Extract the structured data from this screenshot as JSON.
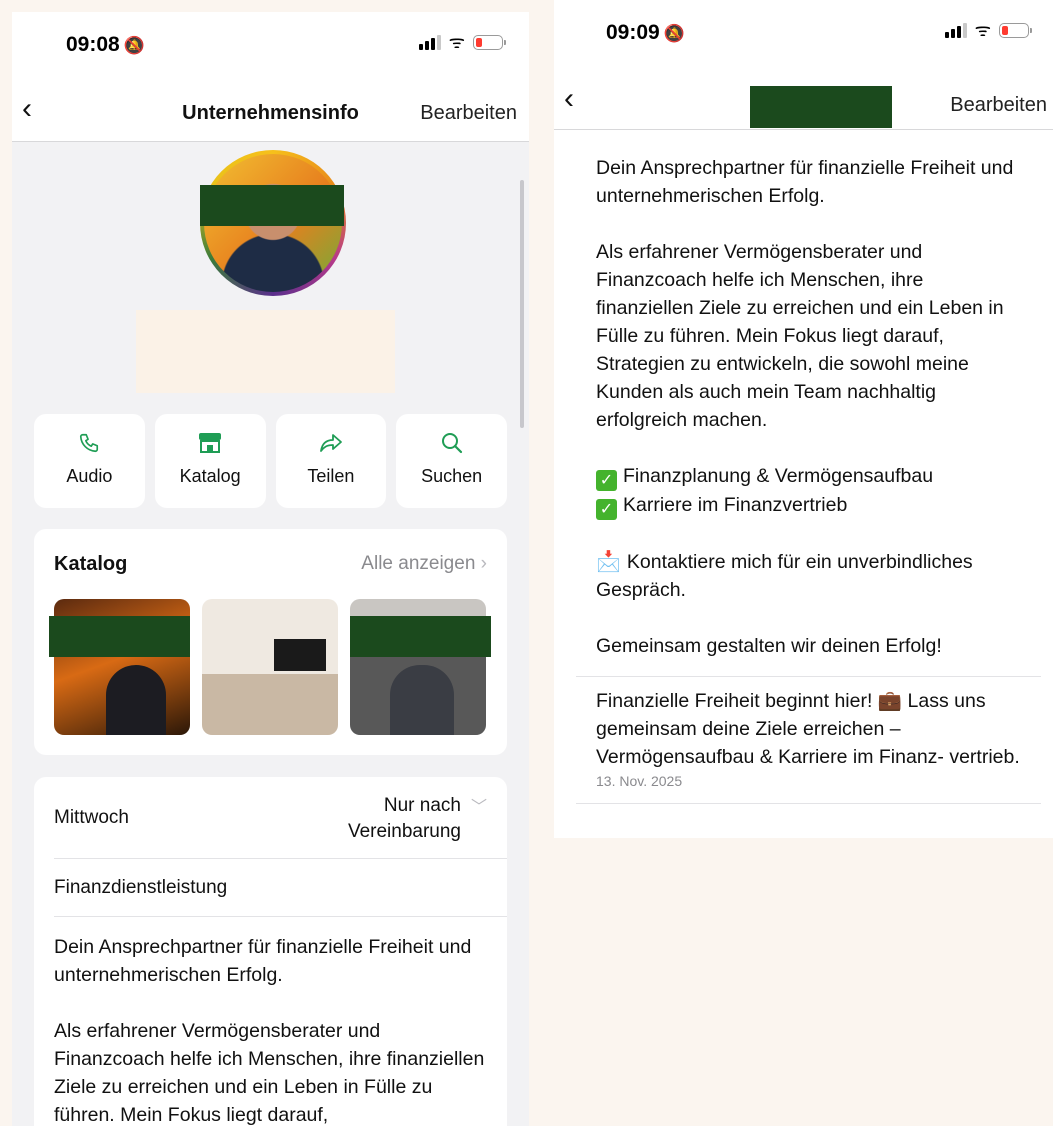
{
  "colors": {
    "accent_green": "#1f9d55",
    "redaction": "#1b4a1d",
    "background": "#fbf5ef"
  },
  "left": {
    "status": {
      "time": "09:08",
      "bell_icon": "bell-slash-icon"
    },
    "nav": {
      "back_icon": "chevron-left-icon",
      "title": "Unternehmensinfo",
      "edit": "Bearbeiten"
    },
    "actions": [
      {
        "icon": "phone-icon",
        "glyph": "✆",
        "label": "Audio"
      },
      {
        "icon": "storefront-icon",
        "glyph": "🏪",
        "label": "Katalog"
      },
      {
        "icon": "share-icon",
        "glyph": "➦",
        "label": "Teilen"
      },
      {
        "icon": "search-icon",
        "glyph": "⚲",
        "label": "Suchen"
      }
    ],
    "catalog": {
      "title": "Katalog",
      "see_all": "Alle anzeigen"
    },
    "hours": {
      "day": "Mittwoch",
      "line1": "Nur nach",
      "line2": "Vereinbarung"
    },
    "category": "Finanzdienstleistung",
    "description": [
      "Dein Ansprechpartner für finanzielle Freiheit und unternehmerischen Erfolg.",
      "Als erfahrener Vermögensberater und Finanzcoach helfe ich Menschen, ihre finanziellen Ziele zu erreichen und ein Leben in Fülle zu führen. Mein Fokus liegt darauf,"
    ]
  },
  "right": {
    "status": {
      "time": "09:09",
      "bell_icon": "bell-slash-icon"
    },
    "nav": {
      "back_icon": "chevron-left-icon",
      "edit": "Bearbeiten"
    },
    "description": {
      "p1": "Dein Ansprechpartner für finanzielle Freiheit und unternehmerischen Erfolg.",
      "p2": "Als erfahrener Vermögensberater und Finanzcoach helfe ich Menschen, ihre finanziellen Ziele zu erreichen und ein Leben in Fülle zu führen. Mein Fokus liegt darauf, Strategien zu entwickeln, die sowohl meine Kunden als auch mein Team nachhaltig erfolgreich machen.",
      "check1": "Finanzplanung & Vermögensaufbau",
      "check2": "Karriere im Finanzvertrieb",
      "contact": "Kontaktiere mich für ein unverbindliches Gespräch.",
      "closing": "Gemeinsam gestalten wir deinen Erfolg!"
    },
    "post": {
      "text_before": "Finanzielle Freiheit beginnt hier! ",
      "emoji": "💼",
      "text_after": " Lass uns gemeinsam deine Ziele erreichen – Vermögensaufbau & Karriere im Finanz- vertrieb.",
      "date": "13. Nov. 2025"
    }
  }
}
